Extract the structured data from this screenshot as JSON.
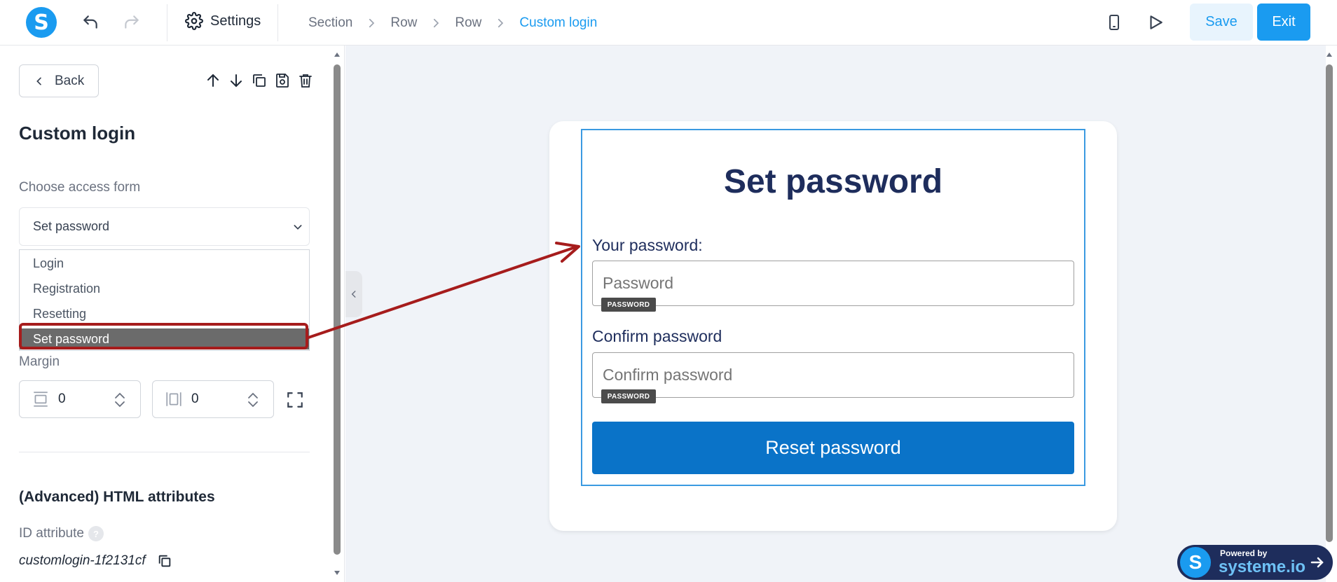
{
  "header": {
    "settings_label": "Settings",
    "breadcrumb": [
      "Section",
      "Row",
      "Row",
      "Custom login"
    ],
    "save_label": "Save",
    "exit_label": "Exit"
  },
  "panel": {
    "back_label": "Back",
    "title": "Custom login",
    "access_form_label": "Choose access form",
    "selected_value": "Set password",
    "options": [
      "Login",
      "Registration",
      "Resetting",
      "Set password"
    ],
    "margin_label": "Margin",
    "margin_vertical": "0",
    "margin_horizontal": "0",
    "advanced_title": "(Advanced) HTML attributes",
    "id_label": "ID attribute",
    "id_help": "?",
    "id_value": "customlogin-1f2131cf"
  },
  "form": {
    "title": "Set password",
    "password_label": "Your password:",
    "password_placeholder": "Password",
    "password_tag": "PASSWORD",
    "confirm_label": "Confirm password",
    "confirm_placeholder": "Confirm password",
    "confirm_tag": "PASSWORD",
    "button_label": "Reset password"
  },
  "badge": {
    "powered_by": "Powered by",
    "brand": "systeme.io"
  },
  "colors": {
    "accent": "#1a9bf0",
    "form_title": "#1e2d5c",
    "button": "#0a73c8",
    "annotation": "#a61c1c"
  }
}
